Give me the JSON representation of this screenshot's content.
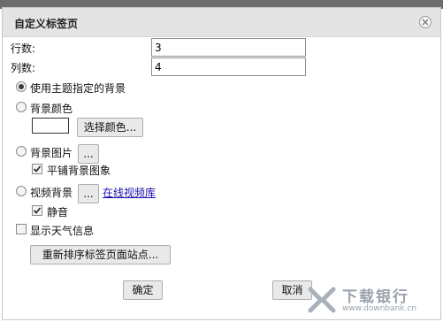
{
  "dialog": {
    "title": "自定义标签页",
    "close_icon": "close-circle-icon"
  },
  "fields": {
    "rows_label": "行数:",
    "rows_value": "3",
    "cols_label": "列数:",
    "cols_value": "4"
  },
  "background": {
    "options": [
      {
        "label": "使用主题指定的背景",
        "selected": true
      },
      {
        "label": "背景颜色",
        "selected": false
      },
      {
        "label": "背景图片",
        "selected": false
      },
      {
        "label": "视频背景",
        "selected": false
      }
    ],
    "color_swatch": "#ffffff",
    "choose_color_button": "选择颜色...",
    "browse_button_label": "...",
    "tile_image_label": "平铺背景图象",
    "tile_image_checked": true,
    "online_video_link": "在线视频库",
    "mute_label": "静音",
    "mute_checked": true
  },
  "weather": {
    "label": "显示天气信息",
    "checked": false
  },
  "reorder_button": "重新排序标签页面站点...",
  "footer": {
    "ok_label": "确定",
    "cancel_label": "取消"
  },
  "watermark": {
    "brand": "下载银行",
    "url": "www.downbank.cn"
  }
}
